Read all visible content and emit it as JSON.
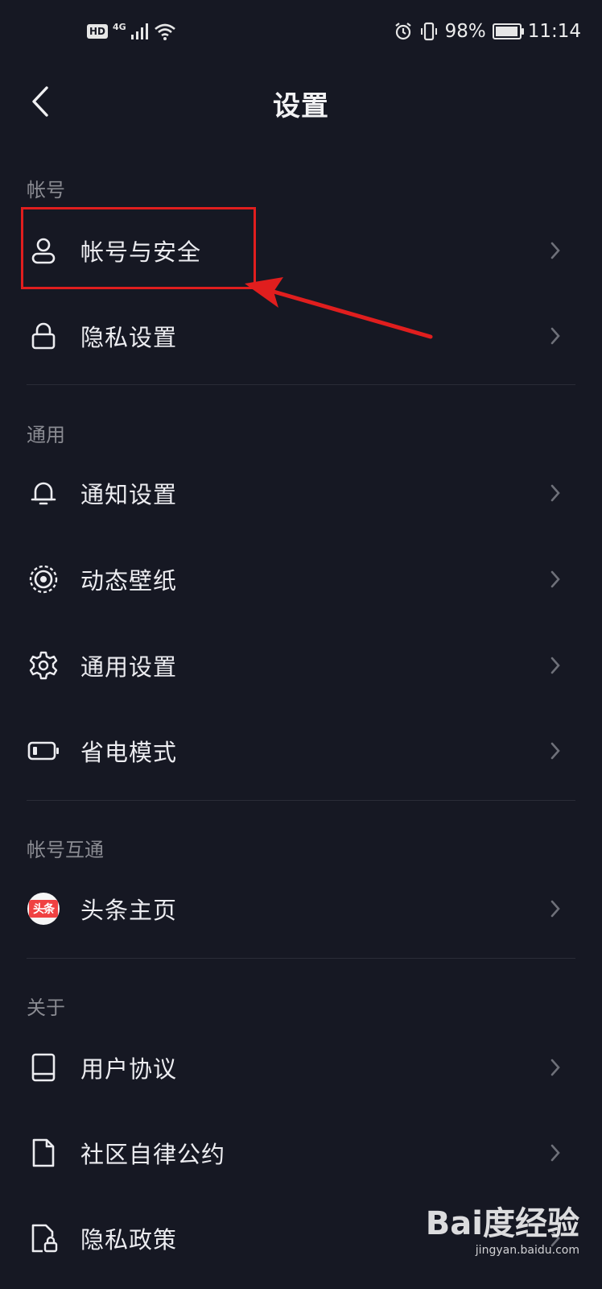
{
  "status_bar": {
    "hd": "HD",
    "network": "4G",
    "battery_text": "98%",
    "battery_level": 0.98,
    "time": "11:14"
  },
  "header": {
    "title": "设置"
  },
  "sections": [
    {
      "title": "帐号",
      "items": [
        {
          "label": "帐号与安全",
          "icon": "person-icon"
        },
        {
          "label": "隐私设置",
          "icon": "lock-icon"
        }
      ]
    },
    {
      "title": "通用",
      "items": [
        {
          "label": "通知设置",
          "icon": "bell-icon"
        },
        {
          "label": "动态壁纸",
          "icon": "live-wallpaper-icon"
        },
        {
          "label": "通用设置",
          "icon": "gear-icon"
        },
        {
          "label": "省电模式",
          "icon": "battery-saver-icon"
        }
      ]
    },
    {
      "title": "帐号互通",
      "items": [
        {
          "label": "头条主页",
          "icon": "toutiao-logo-icon",
          "logo_text": "头条"
        }
      ]
    },
    {
      "title": "关于",
      "items": [
        {
          "label": "用户协议",
          "icon": "book-icon"
        },
        {
          "label": "社区自律公约",
          "icon": "document-icon"
        },
        {
          "label": "隐私政策",
          "icon": "privacy-policy-icon"
        }
      ]
    }
  ],
  "watermark": {
    "logo": "Bai度经验",
    "url": "jingyan.baidu.com"
  },
  "colors": {
    "background": "#161823",
    "annotation": "#e01e1e",
    "toutiao": "#f04142"
  }
}
